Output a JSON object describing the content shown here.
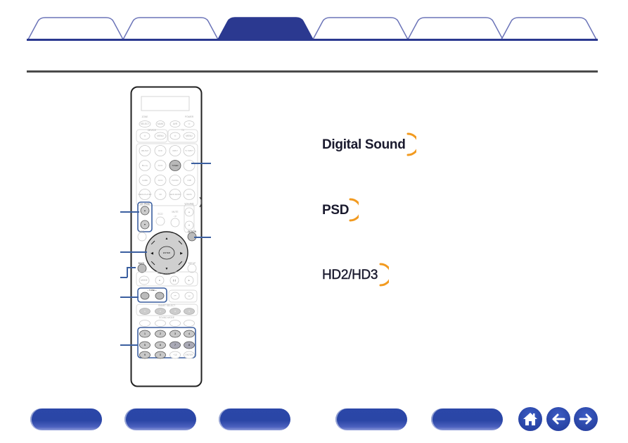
{
  "tabs": [
    {
      "label": "",
      "active": false
    },
    {
      "label": "",
      "active": false
    },
    {
      "label": "",
      "active": true
    },
    {
      "label": "",
      "active": false
    },
    {
      "label": "",
      "active": false
    },
    {
      "label": "",
      "active": false
    }
  ],
  "colors": {
    "brand_blue": "#2b3990",
    "tab_outline": "#6b74b8",
    "logo_arc": "#f29a1f",
    "callout_line": "#3b5fa0"
  },
  "remote": {
    "labels": {
      "zone": "ZONE",
      "power": "POWER",
      "select": "SELECT",
      "main": "MAIN",
      "on_off": "ON/OFF",
      "device": "DEVICE",
      "tv": "TV",
      "setup_source": "SETUP",
      "input": "INPUT",
      "tv_input": "TV INPUT",
      "cbl_sat": "CBL/SAT",
      "dvd": "DVD",
      "bluray": "Blu-ray",
      "aux1": "AUX1",
      "tuner": "TUNER",
      "game": "GAME",
      "aux2": "AUX2",
      "phono": "PHONO",
      "usb": "USB",
      "media_player": "MEDIA PLAYER",
      "cd": "CD",
      "heos_music": "HEOS MUSIC",
      "channel_page": "CH / PAGE",
      "volume": "VOLUME",
      "mute": "MUTE",
      "info": "INFO",
      "option": "OPTION",
      "enter": "ENTER",
      "back": "BACK",
      "setup": "SETUP",
      "tune": "TUNE",
      "tune_minus": "−",
      "tune_plus": "+",
      "smart_select": "SMART SELECT",
      "sound_mode": "SOUND MODE",
      "movie": "MOVIE",
      "music": "MUSIC",
      "game_mode": "GAME",
      "pure": "PURE",
      "plus10": "+10",
      "enter_key": "ENTER",
      "smart_keys": [
        "1",
        "2",
        "3",
        "4"
      ],
      "number_keys": [
        "1",
        "2",
        "3",
        "4",
        "5",
        "6",
        "7",
        "8",
        "9",
        "0"
      ]
    }
  },
  "logos": [
    {
      "name": "digital-sound",
      "text": "Digital Sound"
    },
    {
      "name": "psd",
      "text": "PSD"
    },
    {
      "name": "hd2-hd3",
      "text": "HD2/HD3"
    }
  ],
  "bottom_nav": {
    "buttons": [
      "",
      "",
      "",
      "",
      ""
    ],
    "home_icon": "home-icon",
    "back_icon": "arrow-left-icon",
    "forward_icon": "arrow-right-icon"
  }
}
